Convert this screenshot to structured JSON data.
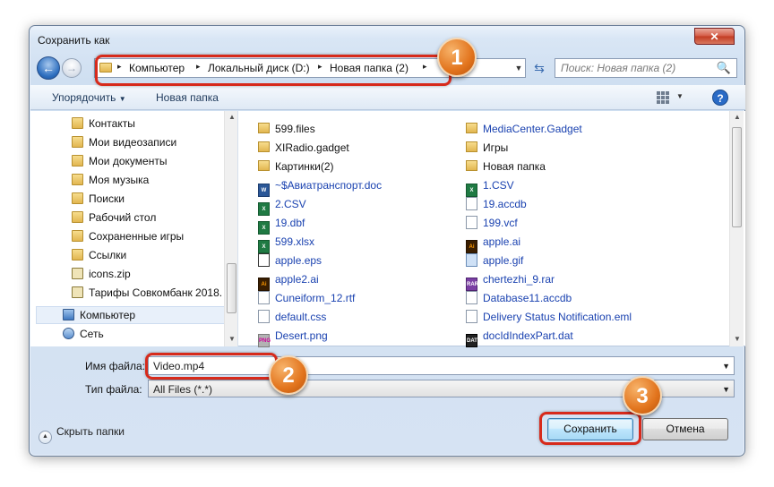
{
  "window": {
    "title": "Сохранить как",
    "close_label": "✕"
  },
  "nav_buttons": {
    "back_glyph": "←",
    "forward_glyph": "→"
  },
  "address": {
    "crumbs": [
      "Компьютер",
      "Локальный диск (D:)",
      "Новая папка (2)"
    ],
    "separator": "▸",
    "dropdown_glyph": "▼",
    "refresh_glyph": "⇆"
  },
  "search": {
    "placeholder": "Поиск: Новая папка (2)",
    "icon": "🔍"
  },
  "toolbar": {
    "organize_label": "Упорядочить",
    "organize_arrow": "▼",
    "new_folder_label": "Новая папка",
    "view_arrow": "▼",
    "help_label": "?"
  },
  "nav_pane": {
    "items": [
      {
        "label": "Контакты",
        "icon": "folder-icon"
      },
      {
        "label": "Мои видеозаписи",
        "icon": "folder-icon"
      },
      {
        "label": "Мои документы",
        "icon": "folder-icon"
      },
      {
        "label": "Моя музыка",
        "icon": "folder-icon"
      },
      {
        "label": "Поиски",
        "icon": "folder-icon"
      },
      {
        "label": "Рабочий стол",
        "icon": "folder-icon"
      },
      {
        "label": "Сохраненные игры",
        "icon": "folder-icon"
      },
      {
        "label": "Ссылки",
        "icon": "folder-icon"
      },
      {
        "label": "icons.zip",
        "icon": "zip-icon"
      },
      {
        "label": "Тарифы Совкомбанк 2018.",
        "icon": "zip-icon"
      },
      {
        "label": "Компьютер",
        "icon": "computer-icon"
      },
      {
        "label": "Сеть",
        "icon": "network-icon"
      }
    ]
  },
  "files": {
    "col1": [
      {
        "name": "599.files",
        "type": "folder"
      },
      {
        "name": "XIRadio.gadget",
        "type": "folder"
      },
      {
        "name": "Картинки(2)",
        "type": "folder"
      },
      {
        "name": "~$Авиатранспорт.doc",
        "type": "word"
      },
      {
        "name": "2.CSV",
        "type": "excel"
      },
      {
        "name": "19.dbf",
        "type": "excel"
      },
      {
        "name": "599.xlsx",
        "type": "excel"
      },
      {
        "name": "apple.eps",
        "type": "eps"
      },
      {
        "name": "apple2.ai",
        "type": "ai"
      },
      {
        "name": "Cuneiform_12.rtf",
        "type": "doc"
      },
      {
        "name": "default.css",
        "type": "doc"
      },
      {
        "name": "Desert.png",
        "type": "png"
      }
    ],
    "col2": [
      {
        "name": "MediaCenter.Gadget",
        "type": "folder"
      },
      {
        "name": "Игры",
        "type": "folder"
      },
      {
        "name": "Новая папка",
        "type": "folder"
      },
      {
        "name": "1.CSV",
        "type": "excel"
      },
      {
        "name": "19.accdb",
        "type": "doc"
      },
      {
        "name": "199.vcf",
        "type": "doc"
      },
      {
        "name": "apple.ai",
        "type": "ai"
      },
      {
        "name": "apple.gif",
        "type": "gif"
      },
      {
        "name": "chertezhi_9.rar",
        "type": "rar"
      },
      {
        "name": "Database11.accdb",
        "type": "doc"
      },
      {
        "name": "Delivery Status Notification.eml",
        "type": "doc"
      },
      {
        "name": "docIdIndexPart.dat",
        "type": "dat"
      }
    ]
  },
  "form": {
    "filename_label": "Имя файла:",
    "filename_value": "Video.mp4",
    "filetype_label": "Тип файла:",
    "filetype_value": "All Files (*.*)"
  },
  "footer": {
    "hide_folders_label": "Скрыть папки",
    "save_label": "Сохранить",
    "cancel_label": "Отмена"
  },
  "annotations": {
    "badge1": "1",
    "badge2": "2",
    "badge3": "3",
    "highlight_color": "#d72a1b",
    "badge_color": "#e2741d"
  }
}
